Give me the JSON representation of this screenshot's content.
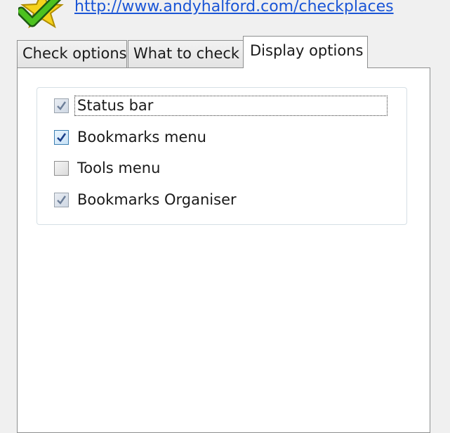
{
  "header": {
    "link_text": "http://www.andyhalford.com/checkplaces",
    "logo_icon": "green-checkmark-star-icon"
  },
  "tabs": [
    {
      "label": "Check options",
      "active": false
    },
    {
      "label": "What to check",
      "active": false
    },
    {
      "label": "Display options",
      "active": true
    }
  ],
  "display_options": {
    "items": [
      {
        "label": "Status bar",
        "checked": true,
        "focused": true
      },
      {
        "label": "Bookmarks menu",
        "checked": true,
        "focused": false
      },
      {
        "label": "Tools menu",
        "checked": false,
        "focused": false
      },
      {
        "label": "Bookmarks Organiser",
        "checked": true,
        "focused": false
      }
    ]
  },
  "colors": {
    "link": "#1a55d6",
    "check_mark_dim": "#6d7f99",
    "check_mark_strong": "#1b3f8a"
  }
}
